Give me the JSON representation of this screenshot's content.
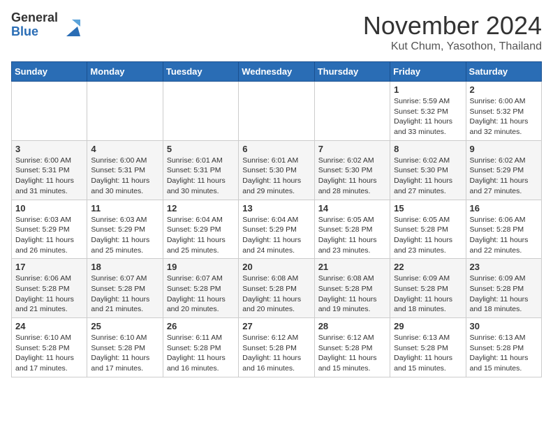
{
  "logo": {
    "general": "General",
    "blue": "Blue"
  },
  "header": {
    "month": "November 2024",
    "location": "Kut Chum, Yasothon, Thailand"
  },
  "days_of_week": [
    "Sunday",
    "Monday",
    "Tuesday",
    "Wednesday",
    "Thursday",
    "Friday",
    "Saturday"
  ],
  "weeks": [
    [
      {
        "day": "",
        "info": ""
      },
      {
        "day": "",
        "info": ""
      },
      {
        "day": "",
        "info": ""
      },
      {
        "day": "",
        "info": ""
      },
      {
        "day": "",
        "info": ""
      },
      {
        "day": "1",
        "info": "Sunrise: 5:59 AM\nSunset: 5:32 PM\nDaylight: 11 hours and 33 minutes."
      },
      {
        "day": "2",
        "info": "Sunrise: 6:00 AM\nSunset: 5:32 PM\nDaylight: 11 hours and 32 minutes."
      }
    ],
    [
      {
        "day": "3",
        "info": "Sunrise: 6:00 AM\nSunset: 5:31 PM\nDaylight: 11 hours and 31 minutes."
      },
      {
        "day": "4",
        "info": "Sunrise: 6:00 AM\nSunset: 5:31 PM\nDaylight: 11 hours and 30 minutes."
      },
      {
        "day": "5",
        "info": "Sunrise: 6:01 AM\nSunset: 5:31 PM\nDaylight: 11 hours and 30 minutes."
      },
      {
        "day": "6",
        "info": "Sunrise: 6:01 AM\nSunset: 5:30 PM\nDaylight: 11 hours and 29 minutes."
      },
      {
        "day": "7",
        "info": "Sunrise: 6:02 AM\nSunset: 5:30 PM\nDaylight: 11 hours and 28 minutes."
      },
      {
        "day": "8",
        "info": "Sunrise: 6:02 AM\nSunset: 5:30 PM\nDaylight: 11 hours and 27 minutes."
      },
      {
        "day": "9",
        "info": "Sunrise: 6:02 AM\nSunset: 5:29 PM\nDaylight: 11 hours and 27 minutes."
      }
    ],
    [
      {
        "day": "10",
        "info": "Sunrise: 6:03 AM\nSunset: 5:29 PM\nDaylight: 11 hours and 26 minutes."
      },
      {
        "day": "11",
        "info": "Sunrise: 6:03 AM\nSunset: 5:29 PM\nDaylight: 11 hours and 25 minutes."
      },
      {
        "day": "12",
        "info": "Sunrise: 6:04 AM\nSunset: 5:29 PM\nDaylight: 11 hours and 25 minutes."
      },
      {
        "day": "13",
        "info": "Sunrise: 6:04 AM\nSunset: 5:29 PM\nDaylight: 11 hours and 24 minutes."
      },
      {
        "day": "14",
        "info": "Sunrise: 6:05 AM\nSunset: 5:28 PM\nDaylight: 11 hours and 23 minutes."
      },
      {
        "day": "15",
        "info": "Sunrise: 6:05 AM\nSunset: 5:28 PM\nDaylight: 11 hours and 23 minutes."
      },
      {
        "day": "16",
        "info": "Sunrise: 6:06 AM\nSunset: 5:28 PM\nDaylight: 11 hours and 22 minutes."
      }
    ],
    [
      {
        "day": "17",
        "info": "Sunrise: 6:06 AM\nSunset: 5:28 PM\nDaylight: 11 hours and 21 minutes."
      },
      {
        "day": "18",
        "info": "Sunrise: 6:07 AM\nSunset: 5:28 PM\nDaylight: 11 hours and 21 minutes."
      },
      {
        "day": "19",
        "info": "Sunrise: 6:07 AM\nSunset: 5:28 PM\nDaylight: 11 hours and 20 minutes."
      },
      {
        "day": "20",
        "info": "Sunrise: 6:08 AM\nSunset: 5:28 PM\nDaylight: 11 hours and 20 minutes."
      },
      {
        "day": "21",
        "info": "Sunrise: 6:08 AM\nSunset: 5:28 PM\nDaylight: 11 hours and 19 minutes."
      },
      {
        "day": "22",
        "info": "Sunrise: 6:09 AM\nSunset: 5:28 PM\nDaylight: 11 hours and 18 minutes."
      },
      {
        "day": "23",
        "info": "Sunrise: 6:09 AM\nSunset: 5:28 PM\nDaylight: 11 hours and 18 minutes."
      }
    ],
    [
      {
        "day": "24",
        "info": "Sunrise: 6:10 AM\nSunset: 5:28 PM\nDaylight: 11 hours and 17 minutes."
      },
      {
        "day": "25",
        "info": "Sunrise: 6:10 AM\nSunset: 5:28 PM\nDaylight: 11 hours and 17 minutes."
      },
      {
        "day": "26",
        "info": "Sunrise: 6:11 AM\nSunset: 5:28 PM\nDaylight: 11 hours and 16 minutes."
      },
      {
        "day": "27",
        "info": "Sunrise: 6:12 AM\nSunset: 5:28 PM\nDaylight: 11 hours and 16 minutes."
      },
      {
        "day": "28",
        "info": "Sunrise: 6:12 AM\nSunset: 5:28 PM\nDaylight: 11 hours and 15 minutes."
      },
      {
        "day": "29",
        "info": "Sunrise: 6:13 AM\nSunset: 5:28 PM\nDaylight: 11 hours and 15 minutes."
      },
      {
        "day": "30",
        "info": "Sunrise: 6:13 AM\nSunset: 5:28 PM\nDaylight: 11 hours and 15 minutes."
      }
    ]
  ]
}
